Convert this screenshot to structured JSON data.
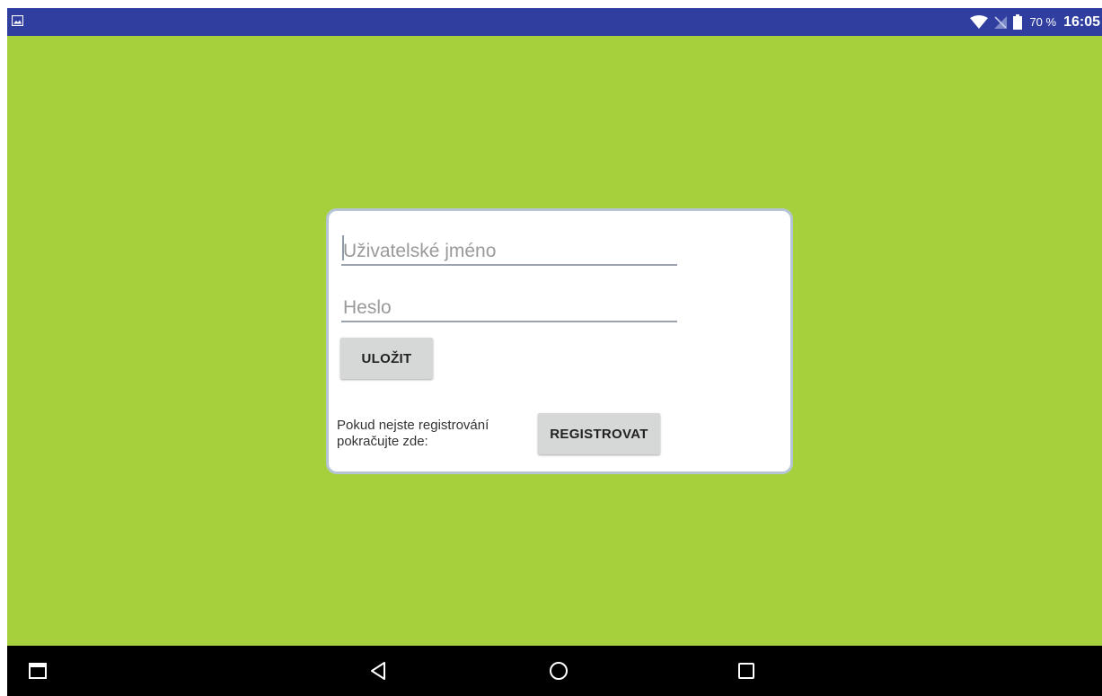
{
  "status_bar": {
    "left_icon": "image-icon",
    "wifi_icon": "wifi-icon",
    "signal_icon": "no-signal-icon",
    "battery_icon": "battery-icon",
    "battery_percent": "70 %",
    "time": "16:05",
    "background_color": "#303f9f"
  },
  "screen": {
    "background_color": "#a6d13d"
  },
  "login_form": {
    "username_placeholder": "Uživatelské jméno",
    "password_placeholder": "Heslo",
    "save_button_label": "ULOŽIT",
    "register_note_line1": "Pokud nejste registrování",
    "register_note_line2": "pokračujte zde:",
    "register_button_label": "REGISTROVAT"
  },
  "nav_bar": {
    "items": [
      {
        "icon": "window-icon"
      },
      {
        "icon": "back-icon"
      },
      {
        "icon": "home-icon"
      },
      {
        "icon": "overview-icon"
      }
    ]
  }
}
